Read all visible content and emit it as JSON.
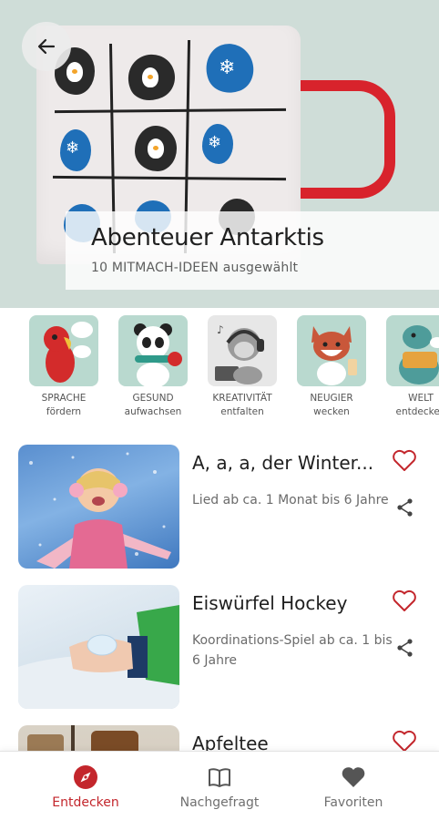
{
  "hero": {
    "title": "Abenteuer Antarktis",
    "subtitle": "10 MITMACH-IDEEN ausgewählt",
    "back_icon": "arrow-left-icon"
  },
  "categories": [
    {
      "line1": "SPRACHE",
      "line2": "fördern",
      "icon": "parrot-illustration"
    },
    {
      "line1": "GESUND",
      "line2": "aufwachsen",
      "icon": "panda-illustration"
    },
    {
      "line1": "KREATIVITÄT",
      "line2": "entfalten",
      "icon": "monkey-headphones-illustration"
    },
    {
      "line1": "NEUGIER",
      "line2": "wecken",
      "icon": "fox-illustration"
    },
    {
      "line1": "WELT",
      "line2": "entdecken",
      "icon": "dino-illustration"
    }
  ],
  "items": [
    {
      "title": "A, a, a, der Winter...",
      "desc": "Lied ab ca. 1 Monat bis 6 Jahre"
    },
    {
      "title": "Eiswürfel Hockey",
      "desc": "Koordinations-Spiel ab ca. 1 bis 6 Jahre"
    },
    {
      "title": "Apfeltee",
      "desc": ""
    }
  ],
  "nav": [
    {
      "label": "Entdecken",
      "icon": "compass-icon",
      "active": true
    },
    {
      "label": "Nachgefragt",
      "icon": "book-icon",
      "active": false
    },
    {
      "label": "Favoriten",
      "icon": "heart-icon",
      "active": false
    }
  ],
  "colors": {
    "accent": "#c3262c",
    "hero_bg": "#cfddd8",
    "tile_bg": "#b9d9cf"
  }
}
